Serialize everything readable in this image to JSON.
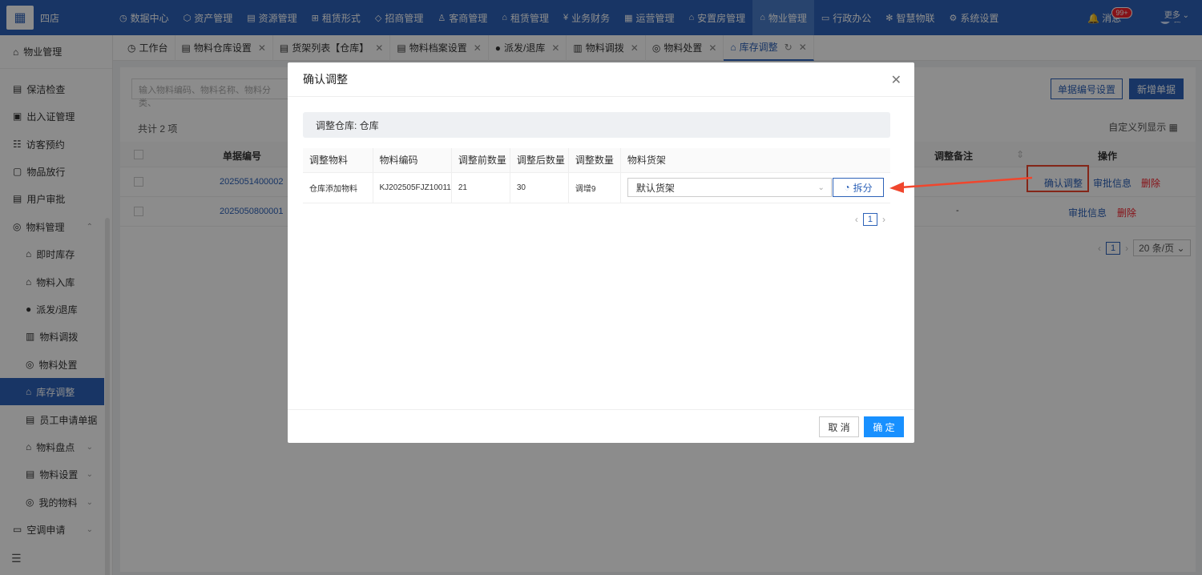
{
  "topnav": {
    "store": "四店",
    "menu": [
      {
        "icon": "◷",
        "label": "数据中心"
      },
      {
        "icon": "⬡",
        "label": "资产管理"
      },
      {
        "icon": "▤",
        "label": "资源管理"
      },
      {
        "icon": "⊞",
        "label": "租赁形式"
      },
      {
        "icon": "◇",
        "label": "招商管理"
      },
      {
        "icon": "♙",
        "label": "客商管理"
      },
      {
        "icon": "⌂",
        "label": "租赁管理"
      },
      {
        "icon": "¥",
        "label": "业务财务"
      },
      {
        "icon": "▦",
        "label": "运营管理"
      },
      {
        "icon": "⌂",
        "label": "安置房管理"
      },
      {
        "icon": "⌂",
        "label": "物业管理"
      },
      {
        "icon": "▭",
        "label": "行政办公"
      },
      {
        "icon": "✻",
        "label": "智慧物联"
      },
      {
        "icon": "⚙",
        "label": "系统设置"
      }
    ],
    "messages": "消息",
    "badge": "99+",
    "user": "邵"
  },
  "sidebar": {
    "title": "物业管理",
    "items": [
      {
        "label": "保洁检查",
        "icon": "▤"
      },
      {
        "label": "出入证管理",
        "icon": "▣"
      },
      {
        "label": "访客预约",
        "icon": "☷"
      },
      {
        "label": "物品放行",
        "icon": "▢"
      },
      {
        "label": "用户审批",
        "icon": "▤"
      },
      {
        "label": "物料管理",
        "icon": "◎"
      },
      {
        "label": "即时库存",
        "icon": "⌂"
      },
      {
        "label": "物料入库",
        "icon": "⌂"
      },
      {
        "label": "派发/退库",
        "icon": "●"
      },
      {
        "label": "物料调拨",
        "icon": "▥"
      },
      {
        "label": "物料处置",
        "icon": "◎"
      },
      {
        "label": "库存调整",
        "icon": "⌂"
      },
      {
        "label": "员工申请单据",
        "icon": "▤"
      },
      {
        "label": "物料盘点",
        "icon": "⌂"
      },
      {
        "label": "物料设置",
        "icon": "▤"
      },
      {
        "label": "我的物料",
        "icon": "◎"
      },
      {
        "label": "空调申请",
        "icon": "▭"
      }
    ]
  },
  "tabs": [
    {
      "label": "工作台",
      "icon": "◷"
    },
    {
      "label": "物料仓库设置",
      "icon": "▤"
    },
    {
      "label": "货架列表【仓库】",
      "icon": "▤"
    },
    {
      "label": "物料档案设置",
      "icon": "▤"
    },
    {
      "label": "派发/退库",
      "icon": "●"
    },
    {
      "label": "物料调拨",
      "icon": "▥"
    },
    {
      "label": "物料处置",
      "icon": "◎"
    },
    {
      "label": "库存调整",
      "icon": "⌂"
    }
  ],
  "more": "更多",
  "main": {
    "search_placeholder": "输入物料编码、物料名称、物料分类、",
    "btn_settings": "单据编号设置",
    "btn_new": "新增单据",
    "total": "共计 2 项",
    "custom_cols": "自定义列显示",
    "col_doc_no": "单据编号",
    "col_remark": "调整备注",
    "col_ops": "操作",
    "rows": [
      {
        "doc_no": "2025051400002",
        "remark": "",
        "confirm": "确认调整",
        "approve": "审批信息",
        "delete": "删除"
      },
      {
        "doc_no": "2025050800001",
        "remark": "-",
        "approve": "审批信息",
        "delete": "删除"
      }
    ],
    "page": "1",
    "page_size": "20 条/页"
  },
  "modal": {
    "title": "确认调整",
    "warehouse": "调整仓库: 仓库",
    "headers": [
      "调整物料",
      "物料编码",
      "调整前数量",
      "调整后数量",
      "调整数量",
      "物料货架"
    ],
    "row": {
      "material": "仓库添加物料",
      "code": "KJ202505FJZ10011",
      "before": "21",
      "after": "30",
      "delta": "调增9",
      "shelf": "默认货架"
    },
    "split": "拆分",
    "page": "1",
    "cancel": "取 消",
    "ok": "确 定"
  }
}
